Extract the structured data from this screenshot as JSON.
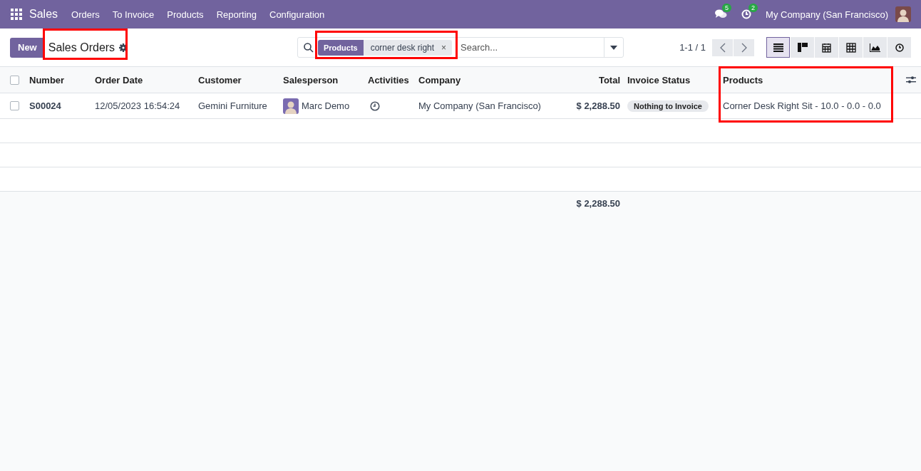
{
  "navbar": {
    "app": "Sales",
    "menu": [
      "Orders",
      "To Invoice",
      "Products",
      "Reporting",
      "Configuration"
    ],
    "messages_count": "5",
    "activities_count": "2",
    "company": "My Company (San Francisco)"
  },
  "control_panel": {
    "new_button": "New",
    "breadcrumb": "Sales Orders",
    "search": {
      "facets": [
        {
          "field": "Products",
          "value": "corner desk right",
          "remove": "×"
        }
      ],
      "placeholder": "Search..."
    },
    "pager": "1-1 / 1",
    "views": [
      {
        "kind": "list",
        "selected": true
      },
      {
        "kind": "kanban",
        "selected": false
      },
      {
        "kind": "calendar",
        "selected": false
      },
      {
        "kind": "pivot",
        "selected": false
      },
      {
        "kind": "graph",
        "selected": false
      },
      {
        "kind": "activity",
        "selected": false
      }
    ]
  },
  "table": {
    "all_checked": false,
    "columns": [
      "Number",
      "Order Date",
      "Customer",
      "Salesperson",
      "Activities",
      "Company",
      "Total",
      "Invoice Status",
      "Products"
    ],
    "rows": [
      {
        "checked": false,
        "number": "S00024",
        "order_date": "12/05/2023 16:54:24",
        "customer": "Gemini Furniture",
        "salesperson": "Marc Demo",
        "company": "My Company (San Francisco)",
        "total": "$ 2,288.50",
        "invoice_status": "Nothing to Invoice",
        "products": "Corner Desk Right Sit - 10.0 - 0.0 - 0.0"
      }
    ],
    "footer_total": "$ 2,288.50"
  }
}
